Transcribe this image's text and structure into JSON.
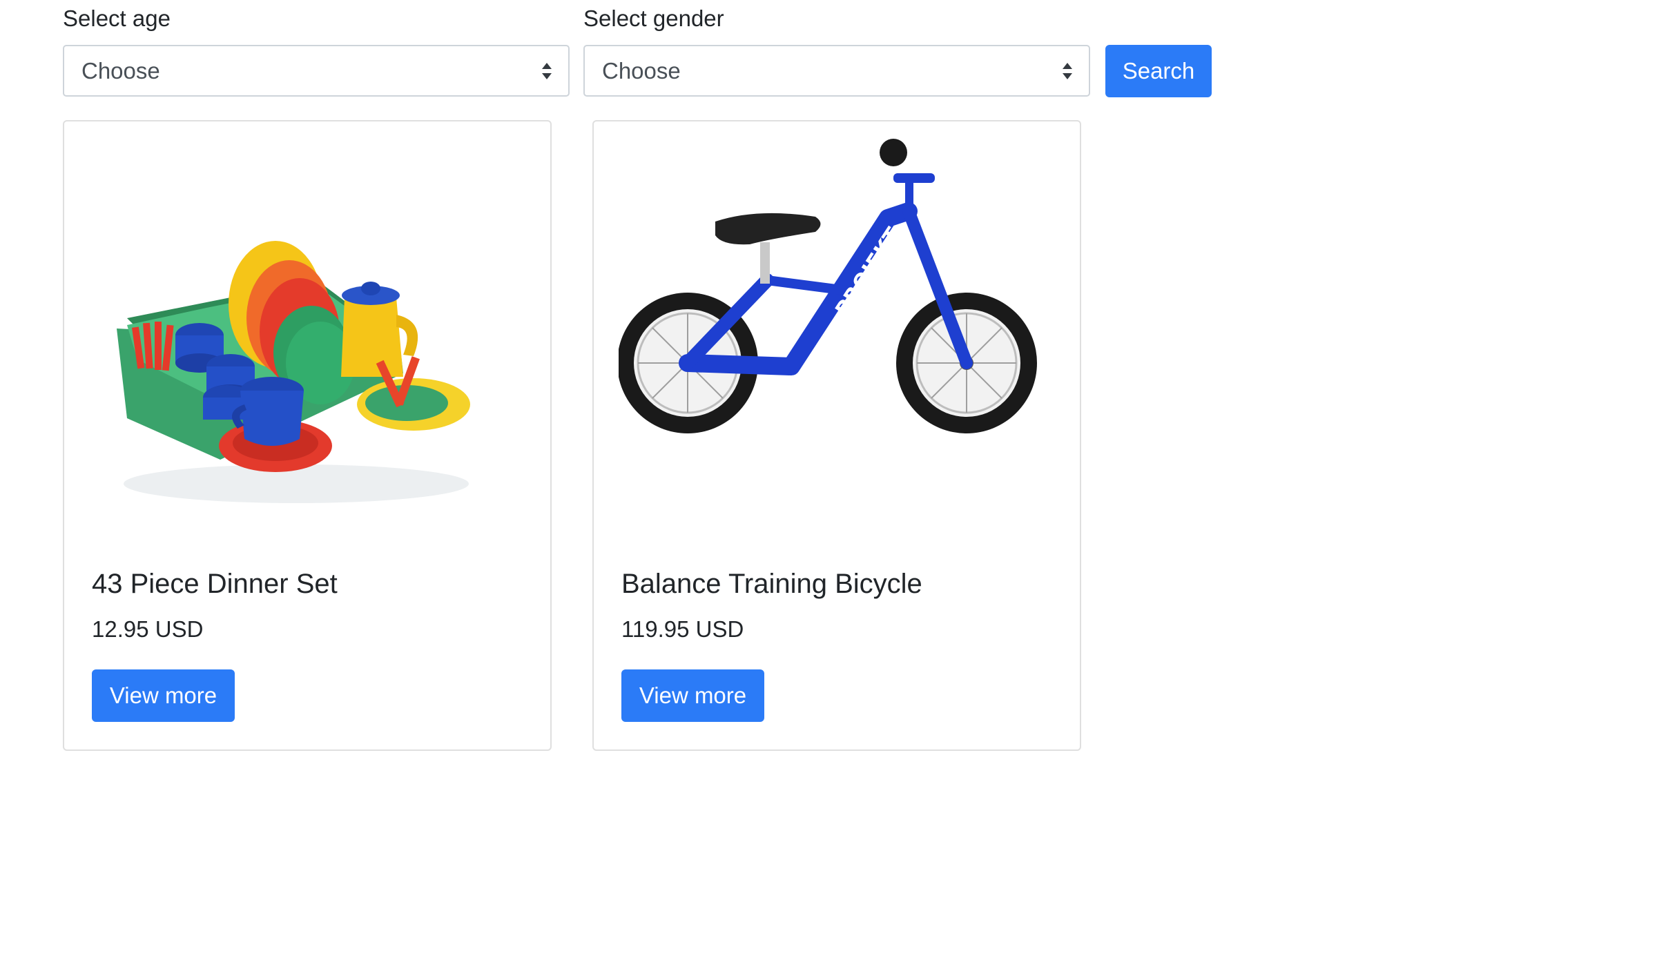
{
  "filters": {
    "age_label": "Select age",
    "age_value": "Choose",
    "gender_label": "Select gender",
    "gender_value": "Choose",
    "search_label": "Search"
  },
  "products": [
    {
      "title": "43 Piece Dinner Set",
      "price": "12.95 USD",
      "button": "View more",
      "image": "toy-dinner-set-image"
    },
    {
      "title": "Balance Training Bicycle",
      "price": "119.95 USD",
      "button": "View more",
      "image": "blue-balance-bicycle-image"
    }
  ],
  "colors": {
    "primary": "#2b7bf7",
    "text": "#212529",
    "border": "#ced4da",
    "bike_frame": "#1e3fd0"
  }
}
